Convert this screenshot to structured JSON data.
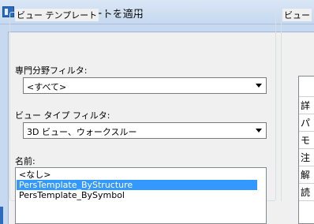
{
  "window": {
    "title": "ビュー テンプレートを適用"
  },
  "view_templates_group": {
    "legend": "ビュー テンプレート",
    "discipline_filter": {
      "label": "専門分野フィルタ:",
      "value": "<すべて>"
    },
    "view_type_filter": {
      "label": "ビュー タイプ フィルタ:",
      "value": "3D ビュー、ウォークスルー"
    },
    "names": {
      "label": "名前:",
      "items": [
        {
          "label": "<なし>",
          "selected": false
        },
        {
          "label": "PersTemplate_ByStructure",
          "selected": true
        },
        {
          "label": "PersTemplate_BySymbol",
          "selected": false
        }
      ]
    }
  },
  "view_properties_group": {
    "legend": "ビュー",
    "rows": [
      "詳",
      "パ",
      "モ",
      "注",
      "解",
      "読"
    ]
  },
  "colors": {
    "selection": "#3399ff",
    "title_bar": "#c6d9f0",
    "dialog_bg": "#f0f0f0"
  },
  "icons": {
    "window_icon": "app-window-icon",
    "dropdown": "chevron-down-icon"
  }
}
